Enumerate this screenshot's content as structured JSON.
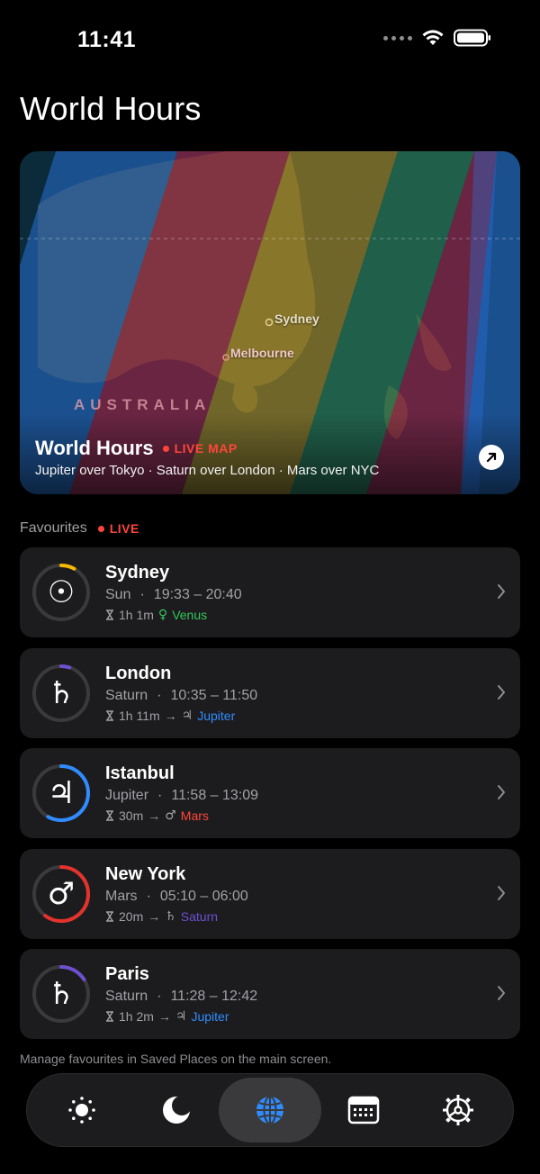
{
  "status_bar": {
    "time": "11:41"
  },
  "page_title": "World Hours",
  "map_card": {
    "title": "World Hours",
    "live_label": "LIVE MAP",
    "subtitle": "Jupiter over Tokyo · Saturn over London · Mars over NYC",
    "country_label": "AUSTRALIA",
    "places": [
      "Sydney",
      "Melbourne"
    ],
    "open_icon": "arrow-up-right-icon"
  },
  "favourites": {
    "header": "Favourites",
    "live_label": "LIVE",
    "items": [
      {
        "city": "Sydney",
        "ruler": "Sun",
        "range": "19:33 – 20:40",
        "remaining": "1h 1m",
        "next_symbol": "♀",
        "next_planet": "Venus",
        "next_color": "#34c759",
        "ruler_symbol": "☉",
        "ring_color": "#f5b800",
        "progress": 0.08
      },
      {
        "city": "London",
        "ruler": "Saturn",
        "range": "10:35 – 11:50",
        "remaining": "1h 11m",
        "next_symbol": "♃",
        "next_planet": "Jupiter",
        "next_color": "#2f8cff",
        "ruler_symbol": "♄",
        "ring_color": "#6e4fd0",
        "progress": 0.05
      },
      {
        "city": "Istanbul",
        "ruler": "Jupiter",
        "range": "11:58 – 13:09",
        "remaining": "30m",
        "next_symbol": "♂",
        "next_planet": "Mars",
        "next_color": "#ff453a",
        "ruler_symbol": "♃",
        "ring_color": "#2f8cff",
        "progress": 0.58
      },
      {
        "city": "New York",
        "ruler": "Mars",
        "range": "05:10 – 06:00",
        "remaining": "20m",
        "next_symbol": "♄",
        "next_planet": "Saturn",
        "next_color": "#6e4fd0",
        "ruler_symbol": "♂",
        "ring_color": "#e5322d",
        "progress": 0.6
      },
      {
        "city": "Paris",
        "ruler": "Saturn",
        "range": "11:28 – 12:42",
        "remaining": "1h 2m",
        "next_symbol": "♃",
        "next_planet": "Jupiter",
        "next_color": "#2f8cff",
        "ruler_symbol": "♄",
        "ring_color": "#6e4fd0",
        "progress": 0.16
      }
    ]
  },
  "footnote": "Manage favourites in Saved Places on the main screen.",
  "tab_bar": {
    "tabs": [
      {
        "icon": "sun-icon",
        "active": false
      },
      {
        "icon": "moon-icon",
        "active": false
      },
      {
        "icon": "globe-icon",
        "active": true
      },
      {
        "icon": "calendar-icon",
        "active": false
      },
      {
        "icon": "settings-icon",
        "active": false
      }
    ]
  },
  "colors": {
    "accent": "#2f8cff",
    "live": "#ff453a",
    "card": "#1c1c1e"
  }
}
